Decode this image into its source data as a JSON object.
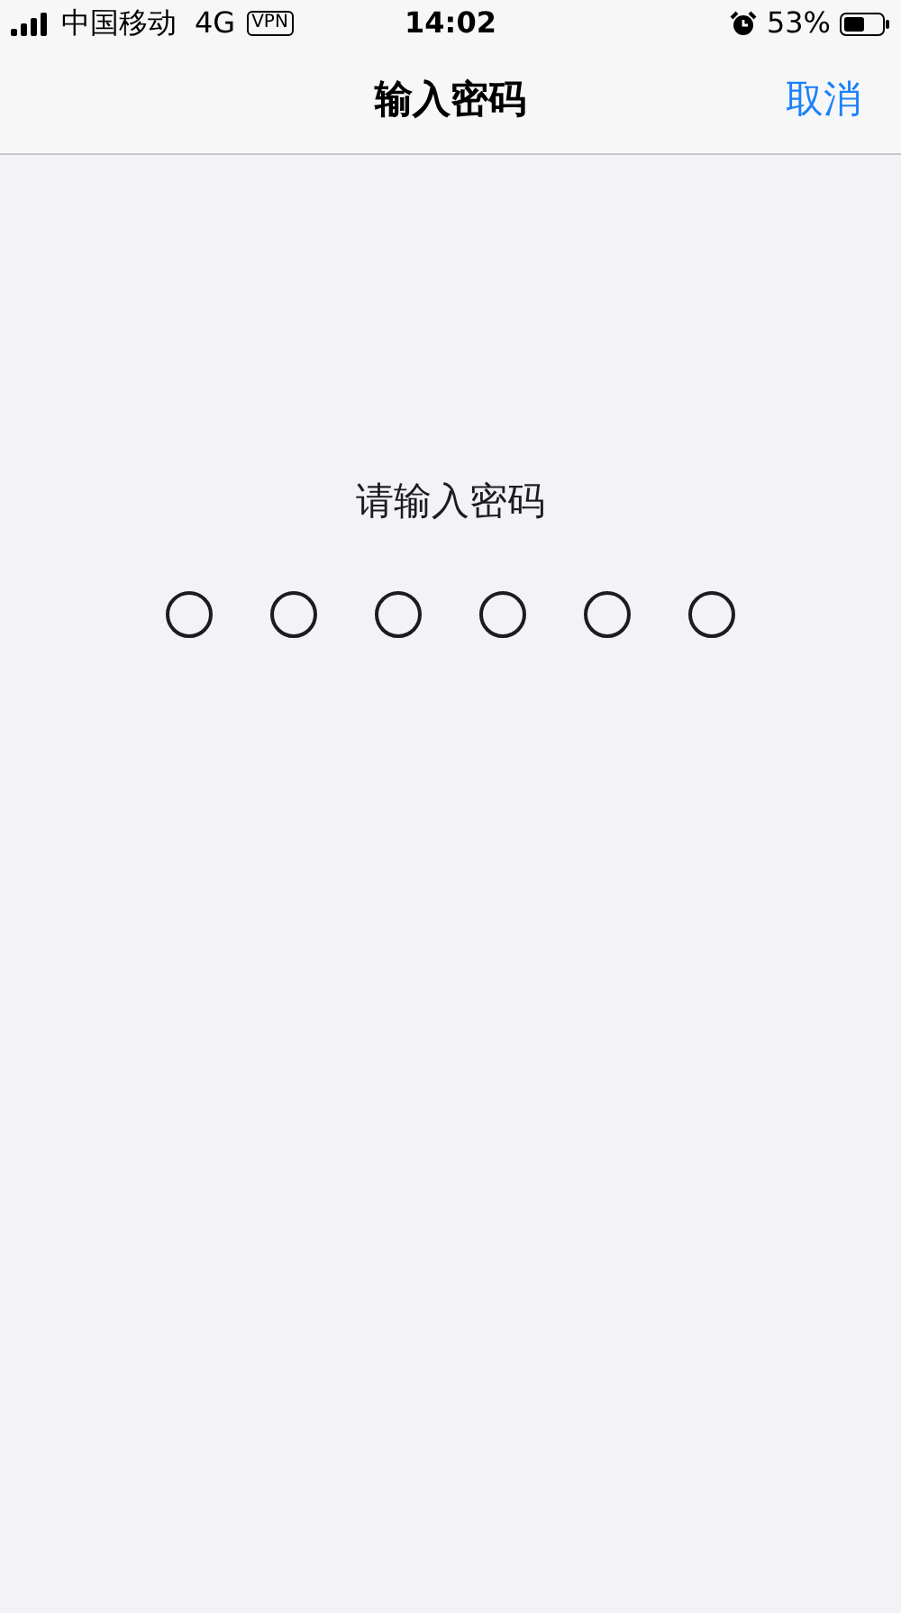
{
  "status_bar": {
    "carrier": "中国移动",
    "network": "4G",
    "vpn": "VPN",
    "time": "14:02",
    "battery": "53%"
  },
  "nav_bar": {
    "title": "输入密码",
    "cancel": "取消"
  },
  "prompt": "请输入密码",
  "passcode_dots": [
    {
      "filled": false
    },
    {
      "filled": false
    },
    {
      "filled": false
    },
    {
      "filled": false
    },
    {
      "filled": false
    },
    {
      "filled": false
    }
  ]
}
